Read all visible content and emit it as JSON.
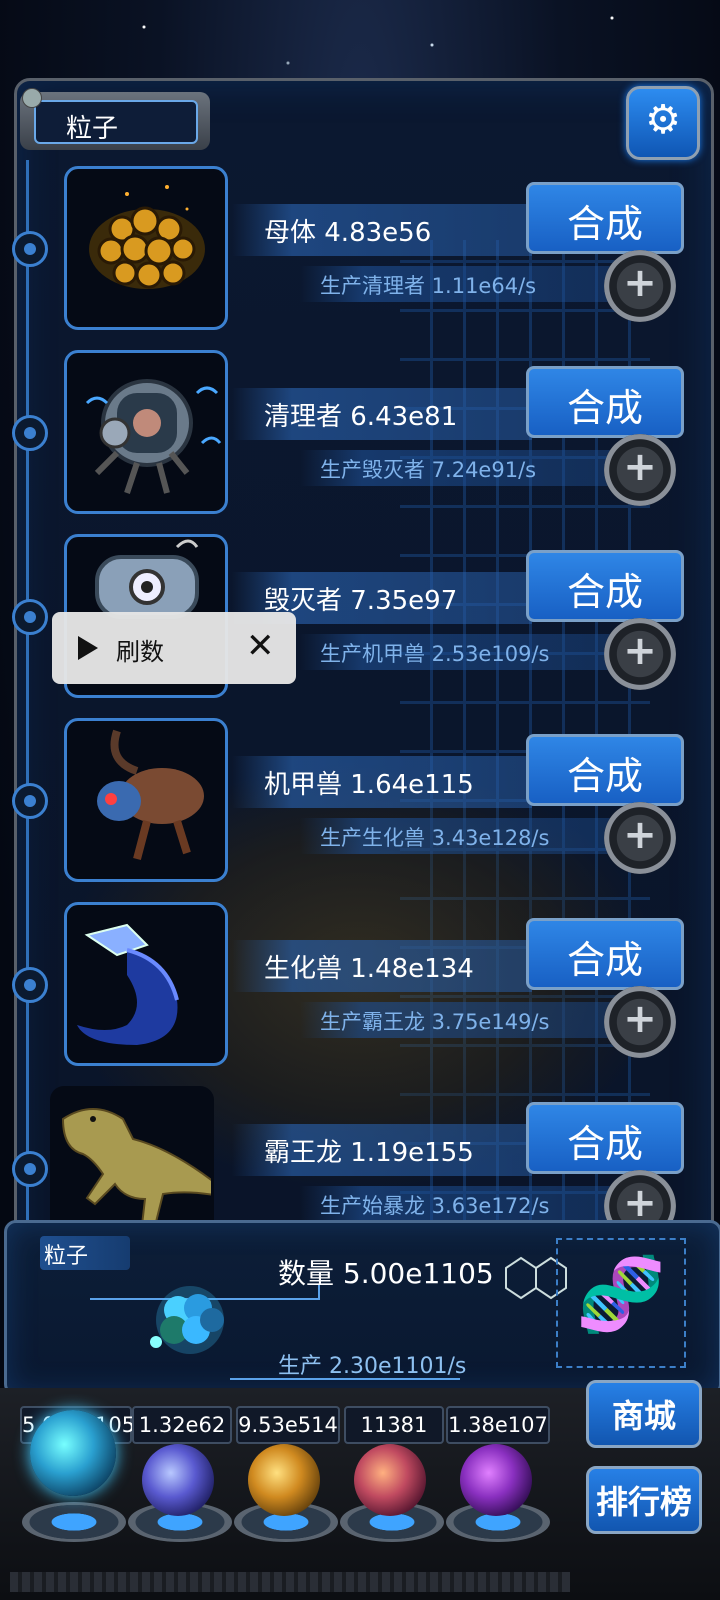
{
  "header": {
    "title": "粒子"
  },
  "creatures": [
    {
      "name": "母体 4.83e56",
      "combine": "合成",
      "produce": "生产清理者 1.11e64/s",
      "icon": "rock-icon"
    },
    {
      "name": "清理者 6.43e81",
      "combine": "合成",
      "produce": "生产毁灭者 7.24e91/s",
      "icon": "robot-icon"
    },
    {
      "name": "毁灭者 7.35e97",
      "combine": "合成",
      "produce": "生产机甲兽 2.53e109/s",
      "icon": "mech-icon"
    },
    {
      "name": "机甲兽 1.64e115",
      "combine": "合成",
      "produce": "生产生化兽 3.43e128/s",
      "icon": "beast-icon"
    },
    {
      "name": "生化兽 1.48e134",
      "combine": "合成",
      "produce": "生产霸王龙 3.75e149/s",
      "icon": "dragon-icon"
    },
    {
      "name": "霸王龙 1.19e155",
      "combine": "合成",
      "produce": "生产始暴龙 3.63e172/s",
      "icon": "trex-icon"
    }
  ],
  "toast": {
    "label": "刷数",
    "close": "✕"
  },
  "bottom_panel": {
    "tag": "粒子",
    "count": "数量 5.00e1105",
    "produce": "生产 2.30e1101/s"
  },
  "resources": [
    "5.00e1105",
    "1.32e62",
    "9.53e514",
    "11381",
    "1.38e107"
  ],
  "side_buttons": {
    "shop": "商城",
    "rank": "排行榜"
  },
  "colors": {
    "accent": "#2f86e6",
    "text_blue": "#7fb2ea",
    "frame": "#3b80d0"
  }
}
